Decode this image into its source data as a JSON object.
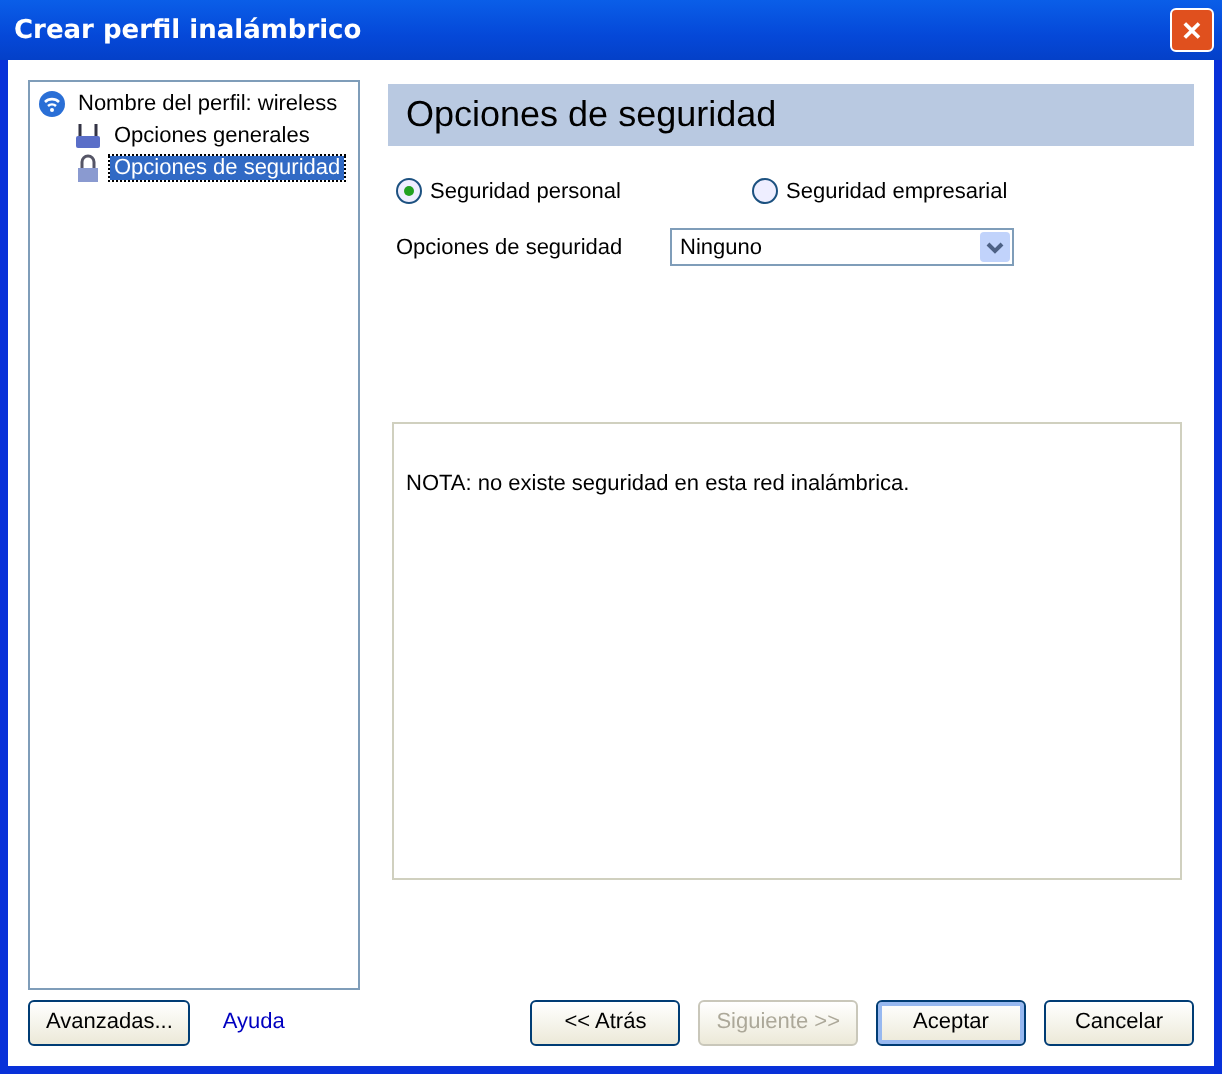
{
  "window": {
    "title": "Crear perfil inalámbrico",
    "close": "✕"
  },
  "tree": {
    "label": "Nombre del perfil: wireless",
    "children": [
      {
        "label": "Opciones generales",
        "selected": false,
        "kind": "router"
      },
      {
        "label": "Opciones de seguridad",
        "selected": true,
        "kind": "lock"
      }
    ]
  },
  "header": "Opciones de seguridad",
  "radios": [
    {
      "label": "Seguridad personal",
      "selected": true
    },
    {
      "label": "Seguridad empresarial",
      "selected": false
    }
  ],
  "security_select": {
    "label": "Opciones de seguridad",
    "value": "Ninguno"
  },
  "note": "NOTA: no existe seguridad en esta red inalámbrica.",
  "advanced_button": "Avanzadas...",
  "help_link": "Ayuda",
  "buttons": [
    {
      "label": "<< Atrás",
      "disabled": false,
      "default": false
    },
    {
      "label": "Siguiente >>",
      "disabled": true,
      "default": false
    },
    {
      "label": "Aceptar",
      "disabled": false,
      "default": true
    },
    {
      "label": "Cancelar",
      "disabled": false,
      "default": false
    }
  ]
}
